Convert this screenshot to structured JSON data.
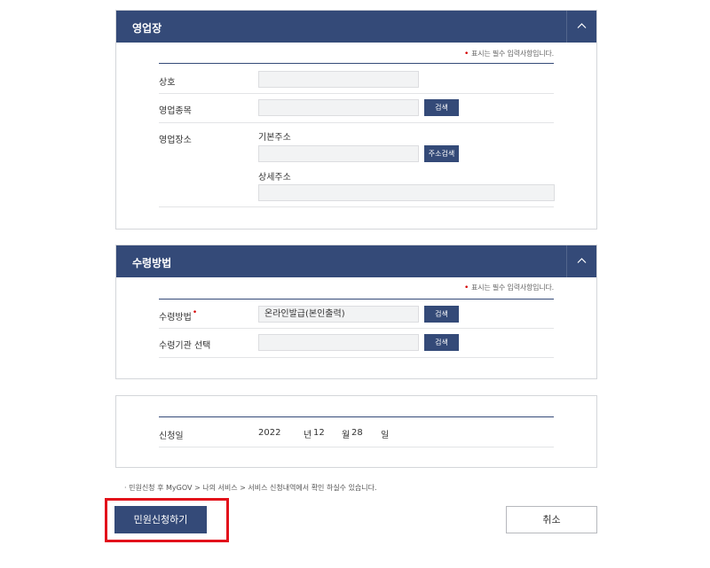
{
  "business": {
    "title": "영업장",
    "required_note": "표시는 필수 입력사항입니다.",
    "name_label": "상호",
    "name_value": "",
    "registration_label": "영업종목",
    "registration_value": "",
    "search_label": "검색",
    "location_label": "영업장소",
    "base_address_label": "기본주소",
    "base_address_value": "",
    "address_search_label": "주소검색",
    "detail_address_label": "상세주소",
    "detail_address_value": ""
  },
  "receipt": {
    "title": "수령방법",
    "required_note": "표시는 필수 입력사항입니다.",
    "method_label": "수령방법",
    "method_value": "온라인발급(본인출력)",
    "search_label": "검색",
    "agency_label": "수령기관 선택",
    "agency_value": "",
    "agency_search_label": "검색"
  },
  "application": {
    "date_label": "신청일",
    "year": "2022",
    "year_unit": "년",
    "month": "12",
    "month_unit": "월",
    "day": "28",
    "day_unit": "일"
  },
  "footer": {
    "note": "민원신청 후 MyGOV > 나의 서비스 > 서비스 신청내역에서 확인 하실수 있습니다.",
    "submit_label": "민원신청하기",
    "cancel_label": "취소"
  },
  "colors": {
    "header": "#344a78",
    "highlight": "#e2111b",
    "required": "#d40000"
  },
  "icons": {
    "toggle": "chevron-up-icon"
  }
}
